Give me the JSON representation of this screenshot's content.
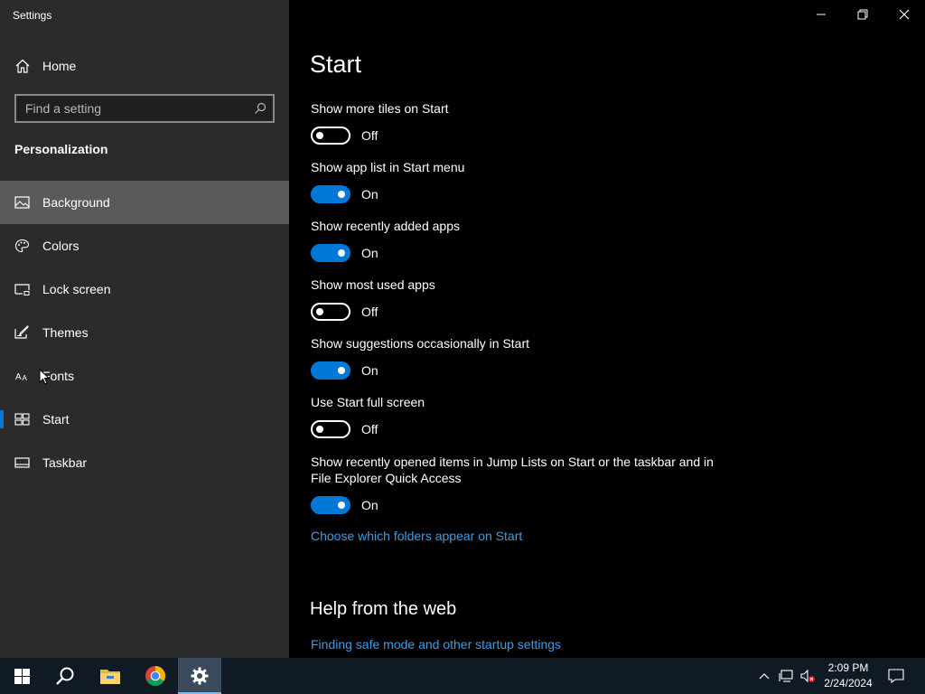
{
  "window": {
    "title": "Settings"
  },
  "sidebar": {
    "home_label": "Home",
    "search": {
      "placeholder": "Find a setting",
      "value": ""
    },
    "section_title": "Personalization",
    "items": [
      {
        "label": "Background",
        "icon": "picture-icon",
        "selected": false,
        "hover": true
      },
      {
        "label": "Colors",
        "icon": "palette-icon",
        "selected": false
      },
      {
        "label": "Lock screen",
        "icon": "lock-screen-icon",
        "selected": false
      },
      {
        "label": "Themes",
        "icon": "themes-icon",
        "selected": false
      },
      {
        "label": "Fonts",
        "icon": "fonts-icon",
        "selected": false
      },
      {
        "label": "Start",
        "icon": "start-icon",
        "selected": true
      },
      {
        "label": "Taskbar",
        "icon": "taskbar-icon",
        "selected": false
      }
    ]
  },
  "main": {
    "title": "Start",
    "settings": [
      {
        "label": "Show more tiles on Start",
        "on": false,
        "state": "Off"
      },
      {
        "label": "Show app list in Start menu",
        "on": true,
        "state": "On"
      },
      {
        "label": "Show recently added apps",
        "on": true,
        "state": "On"
      },
      {
        "label": "Show most used apps",
        "on": false,
        "state": "Off"
      },
      {
        "label": "Show suggestions occasionally in Start",
        "on": true,
        "state": "On"
      },
      {
        "label": "Use Start full screen",
        "on": false,
        "state": "Off"
      },
      {
        "label": "Show recently opened items in Jump Lists on Start or the taskbar and in File Explorer Quick Access",
        "on": true,
        "state": "On"
      }
    ],
    "folders_link": "Choose which folders appear on Start",
    "help_title": "Help from the web",
    "help_link": "Finding safe mode and other startup settings"
  },
  "taskbar": {
    "apps": [
      {
        "icon": "windows-start-icon"
      },
      {
        "icon": "search-icon"
      },
      {
        "icon": "file-explorer-icon"
      },
      {
        "icon": "chrome-icon"
      },
      {
        "icon": "settings-gear-icon",
        "active": true
      }
    ],
    "tray": {
      "time": "2:09 PM",
      "date": "2/24/2024"
    }
  },
  "colors": {
    "accent": "#0078d7",
    "sidebar_bg": "#2b2b2b",
    "link": "#3d9ce6",
    "taskbar_bg": "#101a24"
  }
}
